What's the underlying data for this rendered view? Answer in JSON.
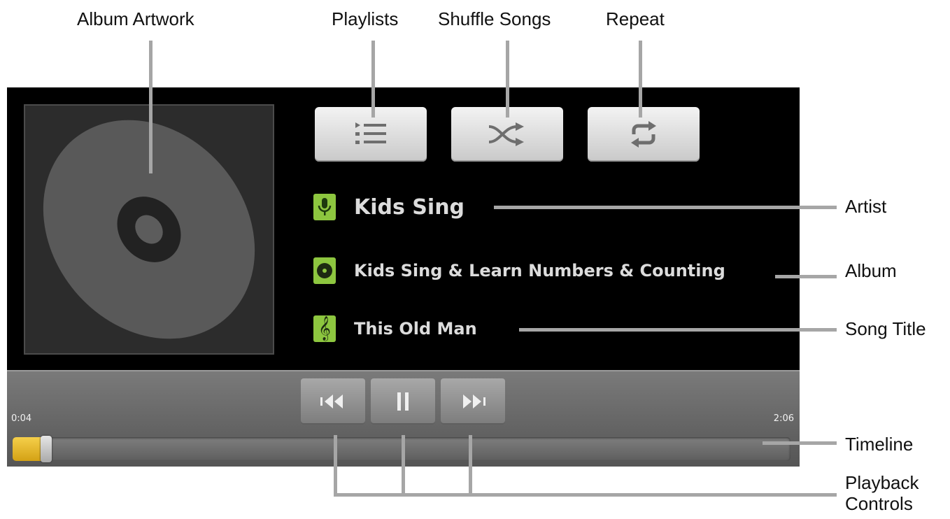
{
  "callouts": {
    "album_artwork": "Album Artwork",
    "playlists": "Playlists",
    "shuffle_songs": "Shuffle Songs",
    "repeat": "Repeat",
    "artist": "Artist",
    "album": "Album",
    "song_title": "Song Title",
    "timeline": "Timeline",
    "playback_controls_line1": "Playback",
    "playback_controls_line2": "Controls"
  },
  "player": {
    "artist": "Kids Sing",
    "album": "Kids Sing & Learn Numbers & Counting",
    "song_title": "This Old Man",
    "elapsed": "0:04",
    "duration": "2:06",
    "progress_fraction": 0.032
  },
  "icons": {
    "playlists": "playlist-icon",
    "shuffle": "shuffle-icon",
    "repeat": "repeat-icon",
    "artist": "microphone-icon",
    "album": "disc-icon",
    "song": "treble-clef-icon",
    "previous": "previous-icon",
    "pause": "pause-icon",
    "next": "next-icon"
  },
  "colors": {
    "accent_green": "#8dc63f",
    "progress_yellow": "#e0b020",
    "leader_gray": "#a6a6a6"
  }
}
